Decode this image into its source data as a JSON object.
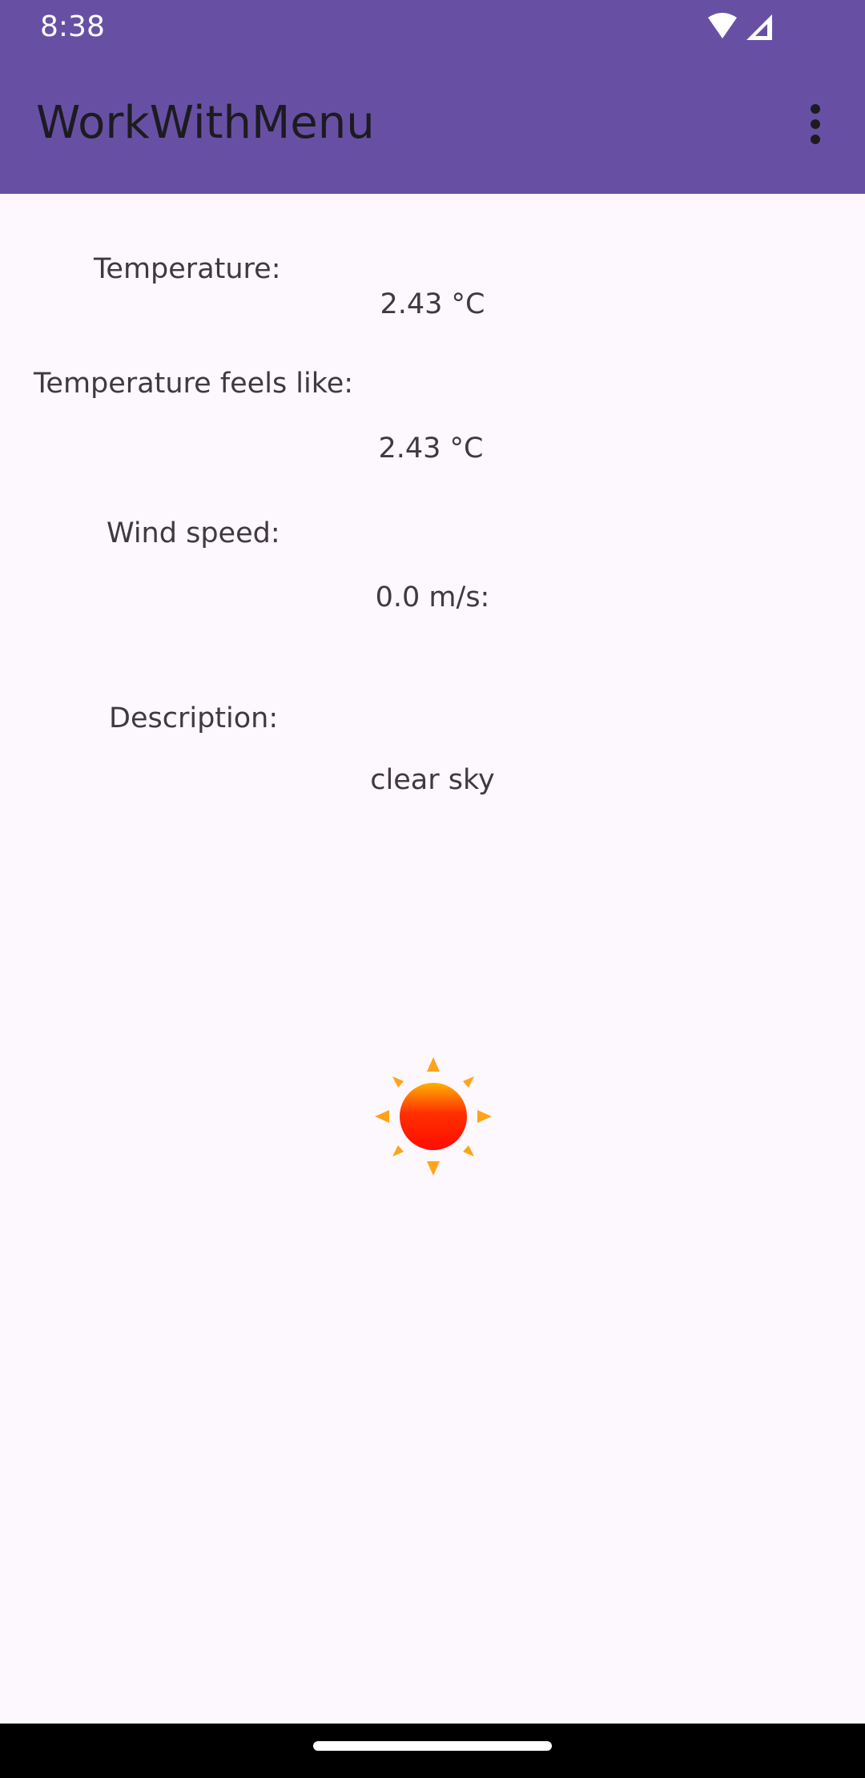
{
  "status_bar": {
    "time": "8:38",
    "icons": [
      "wifi-icon",
      "cellular-signal-icon"
    ]
  },
  "app_bar": {
    "title": "WorkWithMenu",
    "overflow_icon": "more-vert-icon"
  },
  "weather": {
    "temperature_label": "Temperature:",
    "temperature_value": "2.43 °C",
    "feels_like_label": "Temperature feels like:",
    "feels_like_value": "2.43 °C",
    "wind_label": "Wind speed:",
    "wind_value": "0.0 m/s:",
    "description_label": "Description:",
    "description_value": "clear sky",
    "icon": "sun-icon"
  },
  "colors": {
    "app_bar": "#6750a4",
    "background": "#fdf7fe",
    "text": "#3f3a40"
  }
}
